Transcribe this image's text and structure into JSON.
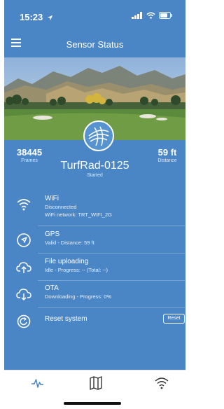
{
  "status_bar": {
    "time": "15:23"
  },
  "header": {
    "title": "Sensor Status",
    "menu_icon": "hamburger-icon"
  },
  "stats": {
    "frames_value": "38445",
    "frames_label": "Frames",
    "distance_value": "59 ft",
    "distance_label": "Distance"
  },
  "device": {
    "name": "TurfRad-0125",
    "status": "Started"
  },
  "rows": [
    {
      "icon": "wifi-icon",
      "title": "WiFi",
      "lines": [
        "Disconnected",
        "WiFi network: TRT_WIFI_2G"
      ]
    },
    {
      "icon": "navigation-icon",
      "title": "GPS",
      "lines": [
        "Valid - Distance: 59 ft"
      ]
    },
    {
      "icon": "cloud-upload-icon",
      "title": "File uploading",
      "lines": [
        "Idle - Progress: -- (Total: --)"
      ]
    },
    {
      "icon": "cloud-download-icon",
      "title": "OTA",
      "lines": [
        "Downloading - Progress: 0%"
      ]
    },
    {
      "icon": "restart-icon",
      "title": "Reset system",
      "lines": []
    }
  ],
  "reset_button_label": "Reset",
  "tabs": [
    "activity-icon",
    "map-icon",
    "wifi-icon"
  ],
  "colors": {
    "primary": "#4a86c5",
    "tab_active": "#4a86c5",
    "tab_inactive": "#333333"
  }
}
